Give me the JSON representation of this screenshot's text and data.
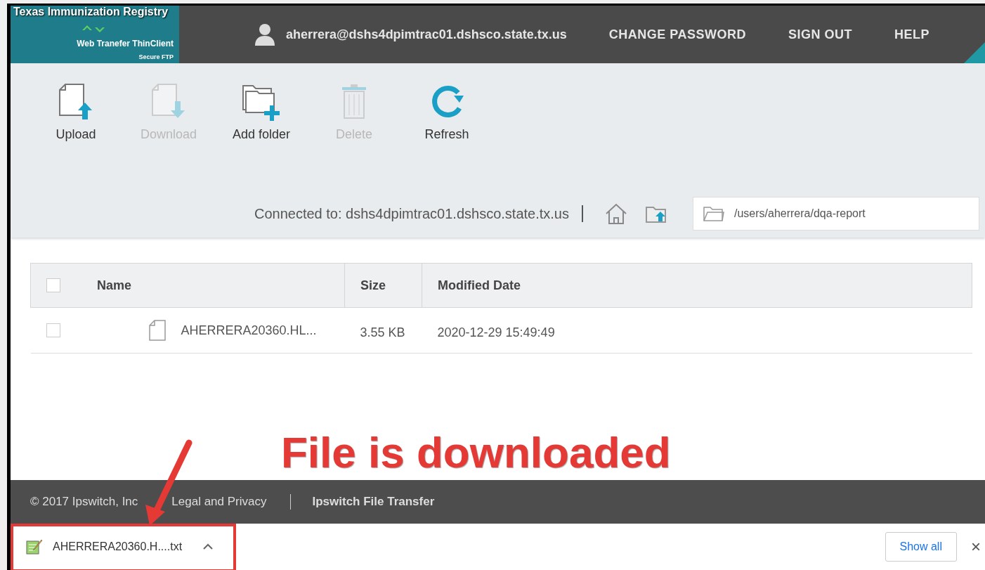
{
  "header": {
    "logo": {
      "title": "Texas Immunization Registry",
      "subtitle": "Web Tranefer ThinClient",
      "tagline": "Secure FTP"
    },
    "user": "aherrera@dshs4dpimtrac01.dshsco.state.tx.us",
    "links": [
      "CHANGE PASSWORD",
      "SIGN OUT",
      "HELP"
    ]
  },
  "toolbar": [
    {
      "kind": "upload",
      "label": "Upload",
      "disabled": false
    },
    {
      "kind": "download",
      "label": "Download",
      "disabled": true
    },
    {
      "kind": "folder",
      "label": "Add folder",
      "disabled": false
    },
    {
      "kind": "delete",
      "label": "Delete",
      "disabled": true
    },
    {
      "kind": "refresh",
      "label": "Refresh",
      "disabled": false
    }
  ],
  "connection": {
    "text": "Connected to: dshs4dpimtrac01.dshsco.state.tx.us",
    "path": "/users/aherrera/dqa-report"
  },
  "table": {
    "columns": [
      "Name",
      "Size",
      "Modified Date"
    ],
    "select_all": {
      "checked": false
    },
    "rows": [
      {
        "checked": false,
        "name": "AHERRERA20360.HL...",
        "size": "3.55 KB",
        "modified": "2020-12-29 15:49:49"
      }
    ]
  },
  "footer": [
    "© 2017 Ipswitch, Inc",
    "Legal and Privacy",
    "Ipswitch File Transfer"
  ],
  "download_bar": {
    "file": "AHERRERA20360.H....txt",
    "button": "Show all",
    "close": "×"
  },
  "annotation": {
    "text": "File is downloaded"
  }
}
